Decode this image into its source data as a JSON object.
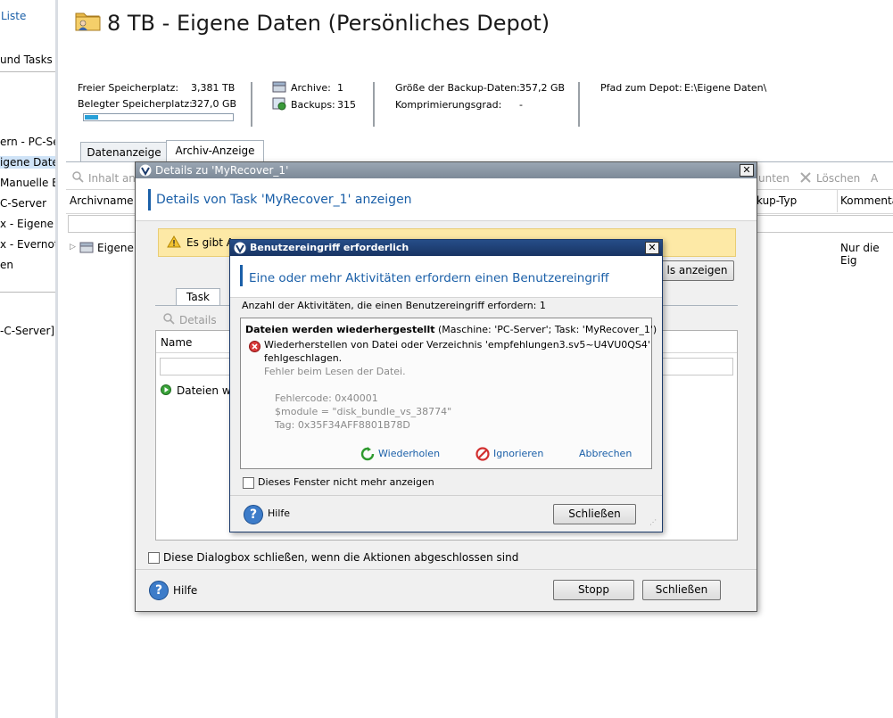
{
  "sidebar": {
    "items": [
      "Liste",
      "und Tasks",
      "ern - PC-Se",
      "igene Daten",
      "Manuelle Ba",
      "C-Server",
      "x - Eigene D",
      "x - Evernote",
      "en",
      "-C-Server]"
    ]
  },
  "header": {
    "title": "8 TB - Eigene Daten (Persönliches Depot)",
    "free_label": "Freier Speicherplatz:",
    "free_value": "3,381 TB",
    "used_label": "Belegter Speicherplatz:",
    "used_value": "327,0 GB",
    "usage_fraction": 0.09,
    "archive_label": "Archive:",
    "archive_value": "1",
    "backups_label": "Backups:",
    "backups_value": "315",
    "backupsize_label": "Größe der Backup-Daten:",
    "backupsize_value": "357,2 GB",
    "compression_label": "Komprimierungsgrad:",
    "compression_value": "-",
    "path_label": "Pfad zum Depot:",
    "path_value": "E:\\Eigene Daten\\"
  },
  "tabs": [
    "Datenanzeige",
    "Archiv-Anzeige"
  ],
  "toolbar": {
    "inhalt": "Inhalt anz",
    "unten": "unten",
    "loeschen": "Löschen",
    "more": "A"
  },
  "table": {
    "col_archivname": "Archivname",
    "col_typ": "kup-Typ",
    "col_kommentar": "Kommenta",
    "row_name": "Eigene D",
    "row_comment": "Nur die Eig"
  },
  "details_dialog": {
    "title": "Details zu 'MyRecover_1'",
    "heading": "Details von Task 'MyRecover_1' anzeigen",
    "warning": "Es gibt A",
    "show_details_btn": "ls anzeigen",
    "tab_task": "Task",
    "details_btn": "Details",
    "col_name": "Name",
    "row_item": "Dateien we",
    "checkbox_label": "Diese Dialogbox schließen, wenn die Aktionen abgeschlossen sind",
    "help": "Hilfe",
    "stop_btn": "Stopp",
    "close_btn": "Schließen"
  },
  "intervention_dialog": {
    "title": "Benutzereingriff erforderlich",
    "heading": "Eine oder mehr Aktivitäten erfordern einen Benutzereingriff",
    "count_text": "Anzahl der Aktivitäten, die einen Benutzereingriff erfordern: 1",
    "activity_bold": "Dateien werden wiederhergestellt",
    "activity_rest": " (Maschine: 'PC-Server'; Task: 'MyRecover_1')",
    "error_line1": "Wiederherstellen von Datei oder Verzeichnis 'empfehlungen3.sv5~U4VU0QS4'",
    "error_line2": "fehlgeschlagen.",
    "error_reason": "Fehler beim Lesen der Datei.",
    "error_code": "Fehlercode: 0x40001",
    "error_module": "$module = \"disk_bundle_vs_38774\"",
    "error_tag": "Tag: 0x35F34AFF8801B78D",
    "retry": "Wiederholen",
    "ignore": "Ignorieren",
    "cancel": "Abbrechen",
    "checkbox_label": "Dieses Fenster nicht mehr anzeigen",
    "help": "Hilfe",
    "close_btn": "Schließen"
  },
  "colors": {
    "titlebar": "#1b3a6b",
    "heading": "#1a5fa8",
    "warning_bg": "#fde9a6",
    "accent": "#28a0d8"
  }
}
